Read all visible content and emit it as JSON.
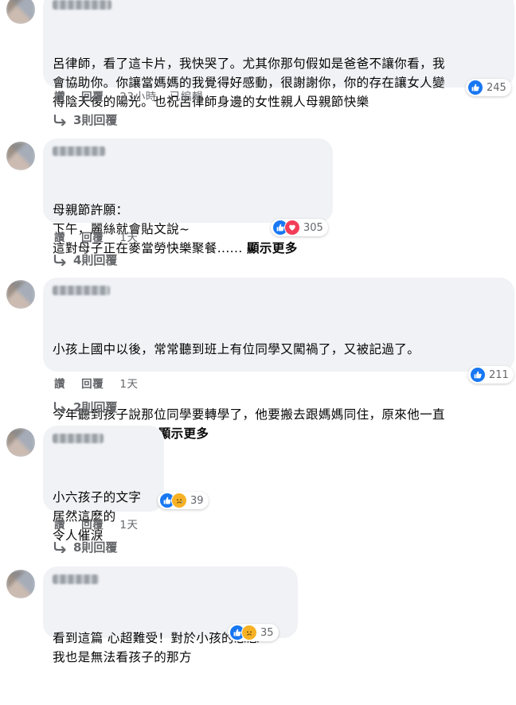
{
  "comments": [
    {
      "text": [
        "呂律師，看了這卡片，我快哭了。尤其你那句假如是爸爸不讓你看，我\n會協助你。你讓當媽媽的我覺得好感動，很謝謝你，你的存在讓女人變\n得陰天後的陽光。也祝呂律師身邊的女性親人母親節快樂"
      ],
      "see_more": "",
      "reactions": {
        "icons": [
          "like-icon"
        ],
        "count": "245"
      },
      "actions": {
        "like": "讚",
        "reply": "回覆",
        "time": "23小時",
        "edited": "已編輯"
      },
      "replies": "3則回覆"
    },
    {
      "text": [
        "母親節許願：\n下午，麗絲就會貼文說~\n這對母子正在麥當勞快樂聚餐......"
      ],
      "see_more": "顯示更多",
      "reactions": {
        "icons": [
          "like-icon",
          "love-icon"
        ],
        "count": "305"
      },
      "actions": {
        "like": "讚",
        "reply": "回覆",
        "time": "1天",
        "edited": ""
      },
      "replies": "4則回覆"
    },
    {
      "text": [
        "小孩上國中以後，常常聽到班上有位同學又闖禍了，又被記過了。",
        "今年聽到孩子說那位同學要轉學了，他要搬去跟媽媽同住，原來他一直\n寄宿嬸嬸家。......"
      ],
      "see_more": "顯示更多",
      "reactions": {
        "icons": [
          "like-icon"
        ],
        "count": "211"
      },
      "actions": {
        "like": "讚",
        "reply": "回覆",
        "time": "1天",
        "edited": ""
      },
      "replies": "2則回覆"
    },
    {
      "text": [
        "小六孩子的文字\n居然這麼的\n令人催淚"
      ],
      "see_more": "",
      "reactions": {
        "icons": [
          "like-icon",
          "sad-icon"
        ],
        "count": "39"
      },
      "actions": {
        "like": "讚",
        "reply": "回覆",
        "time": "1天",
        "edited": ""
      },
      "replies": "8則回覆"
    },
    {
      "text": [
        "看到這篇 心超難受！對於小孩的思念\n我也是無法看孩子的那方"
      ],
      "see_more": "",
      "reactions": {
        "icons": [
          "like-icon",
          "sad-icon"
        ],
        "count": "35"
      },
      "actions": {
        "like": "",
        "reply": "",
        "time": "",
        "edited": ""
      },
      "replies": ""
    }
  ],
  "colors": {
    "bubble": "#f0f2f5",
    "like": "#1877f2",
    "love": "#f33e58",
    "sad": "#f7b125",
    "meta_text": "#65676b"
  }
}
